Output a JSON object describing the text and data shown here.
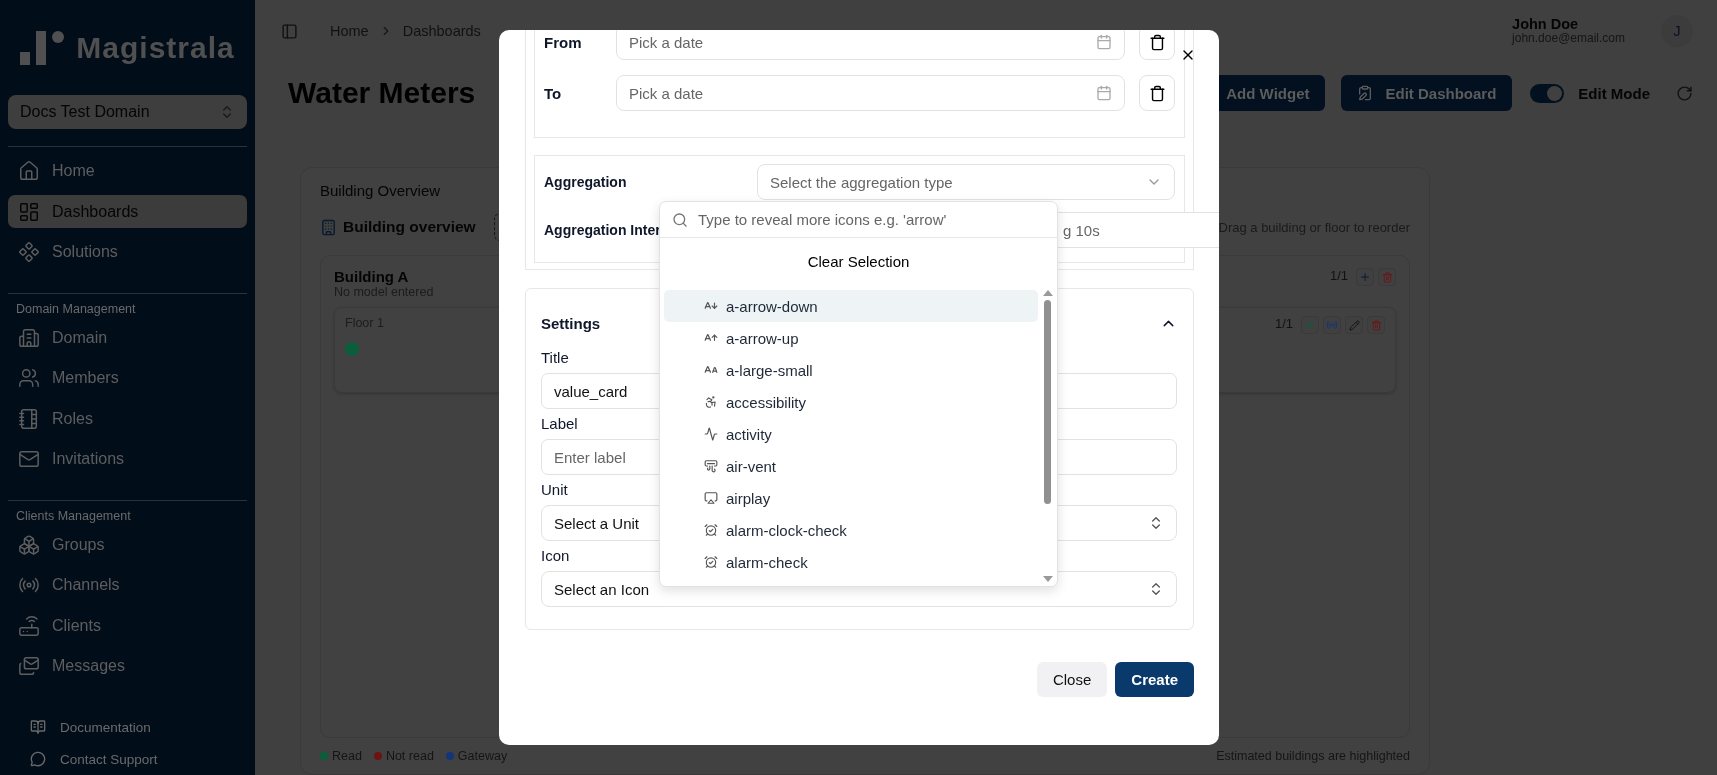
{
  "sidebar": {
    "logo": "Magistrala",
    "domain_selector": "Docs Test Domain",
    "sections": [
      {
        "items": [
          {
            "label": "Home",
            "selected": false
          },
          {
            "label": "Dashboards",
            "selected": true
          },
          {
            "label": "Solutions",
            "selected": false
          }
        ]
      },
      {
        "heading": "Domain Management",
        "items": [
          {
            "label": "Domain",
            "selected": false
          },
          {
            "label": "Members",
            "selected": false
          },
          {
            "label": "Roles",
            "selected": false
          },
          {
            "label": "Invitations",
            "selected": false
          }
        ]
      },
      {
        "heading": "Clients Management",
        "items": [
          {
            "label": "Groups",
            "selected": false
          },
          {
            "label": "Channels",
            "selected": false
          },
          {
            "label": "Clients",
            "selected": false
          },
          {
            "label": "Messages",
            "selected": false
          }
        ]
      }
    ],
    "footer_links": [
      "Documentation",
      "Contact Support"
    ]
  },
  "header": {
    "breadcrumbs": [
      "Home",
      "Dashboards"
    ],
    "user": {
      "name": "John Doe",
      "email": "john.doe@email.com",
      "initial": "J"
    }
  },
  "page": {
    "title": "Water Meters",
    "actions": [
      "Add Widget",
      "Edit Dashboard"
    ],
    "edit_mode": {
      "label": "Edit Mode",
      "on": true
    }
  },
  "widget": {
    "title": "Building Overview",
    "heading": "Building overview",
    "hint": "Drag a building or floor to reorder",
    "buildings": [
      {
        "name": "Building A",
        "model": "No model entered",
        "count": "1/1",
        "floors": [
          {
            "name": "Floor 1",
            "count": "1/1",
            "meters": [
              {
                "color": "#0b5e3b"
              }
            ]
          }
        ]
      }
    ],
    "legend": [
      {
        "label": "Read",
        "color": "#0b5e3b"
      },
      {
        "label": "Not read",
        "color": "#6e1313"
      },
      {
        "label": "Gateway",
        "color": "#14357a"
      }
    ],
    "footnote": "Estimated buildings are highlighted"
  },
  "dialog": {
    "date_range": [
      {
        "label": "From",
        "placeholder": "Pick a date"
      },
      {
        "label": "To",
        "placeholder": "Pick a date"
      }
    ],
    "aggregation": {
      "label": "Aggregation",
      "placeholder": "Select the aggregation type"
    },
    "aggregation_interval": {
      "label": "Aggregation Inter",
      "placeholder": "g 10s"
    },
    "settings": {
      "title": "Settings",
      "expanded": true,
      "fields": [
        {
          "kind": "input",
          "label": "Title",
          "value": "value_card"
        },
        {
          "kind": "input",
          "label": "Label",
          "placeholder": "Enter label"
        },
        {
          "kind": "select",
          "label": "Unit",
          "value": "Select a Unit"
        },
        {
          "kind": "select",
          "label": "Icon",
          "value": "Select an Icon"
        }
      ]
    },
    "buttons": [
      {
        "label": "Close",
        "kind": "secondary"
      },
      {
        "label": "Create",
        "kind": "primary"
      }
    ],
    "icon_picker": {
      "search_placeholder": "Type to reveal more icons e.g. 'arrow'",
      "clear_label": "Clear Selection",
      "options": [
        {
          "name": "a-arrow-down",
          "selected": true
        },
        {
          "name": "a-arrow-up",
          "selected": false
        },
        {
          "name": "a-large-small",
          "selected": false
        },
        {
          "name": "accessibility",
          "selected": false
        },
        {
          "name": "activity",
          "selected": false
        },
        {
          "name": "air-vent",
          "selected": false
        },
        {
          "name": "airplay",
          "selected": false
        },
        {
          "name": "alarm-clock-check",
          "selected": false
        },
        {
          "name": "alarm-check",
          "selected": false
        }
      ]
    }
  }
}
